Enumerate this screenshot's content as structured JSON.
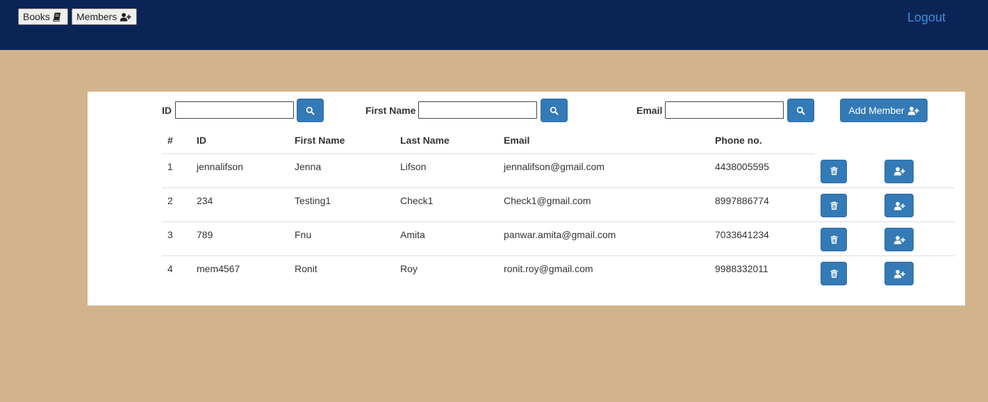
{
  "nav": {
    "books_label": "Books",
    "members_label": "Members",
    "logout_label": "Logout"
  },
  "search": {
    "id_label": "ID",
    "first_name_label": "First Name",
    "email_label": "Email",
    "id_value": "",
    "first_name_value": "",
    "email_value": ""
  },
  "add_member_label": "Add Member",
  "table": {
    "headers": [
      "#",
      "ID",
      "First Name",
      "Last Name",
      "Email",
      "Phone no."
    ],
    "rows": [
      {
        "num": "1",
        "id": "jennalifson",
        "first": "Jenna",
        "last": "Lifson",
        "email": "jennalifson@gmail.com",
        "phone": "4438005595"
      },
      {
        "num": "2",
        "id": "234",
        "first": "Testing1",
        "last": "Check1",
        "email": "Check1@gmail.com",
        "phone": "8997886774"
      },
      {
        "num": "3",
        "id": "789",
        "first": "Fnu",
        "last": "Amita",
        "email": "panwar.amita@gmail.com",
        "phone": "7033641234"
      },
      {
        "num": "4",
        "id": "mem4567",
        "first": "Ronit",
        "last": "Roy",
        "email": "ronit.roy@gmail.com",
        "phone": "9988332011"
      }
    ]
  },
  "icons": {
    "books": "book-icon",
    "members": "user-plus-icon",
    "search": "search-icon",
    "delete": "trash-icon",
    "assign": "user-plus-icon"
  },
  "colors": {
    "navbar": "#0b2456",
    "background": "#d2b48c",
    "primary": "#337ab7",
    "link": "#3a8fd9"
  }
}
